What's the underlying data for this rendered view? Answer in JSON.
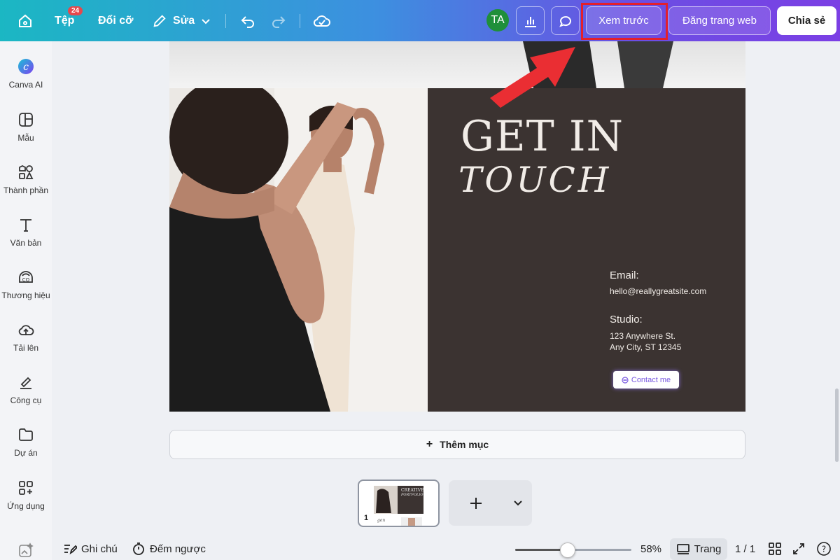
{
  "topbar": {
    "file_label": "Tệp",
    "file_badge": "24",
    "resize_label": "Đổi cỡ",
    "edit_label": "Sửa",
    "avatar_initials": "TA",
    "preview_label": "Xem trước",
    "publish_label": "Đăng trang web",
    "share_label": "Chia sẻ",
    "gradient_colors": [
      "#1bb7c3",
      "#3d8fe0",
      "#6b4fe3",
      "#7b3fe4"
    ]
  },
  "sidebar": {
    "items": [
      {
        "label": "Canva AI",
        "icon": "canva-ai-icon"
      },
      {
        "label": "Mẫu",
        "icon": "templates-icon"
      },
      {
        "label": "Thành phần",
        "icon": "elements-icon"
      },
      {
        "label": "Văn bản",
        "icon": "text-icon"
      },
      {
        "label": "Thương hiệu",
        "icon": "brand-icon"
      },
      {
        "label": "Tải lên",
        "icon": "upload-icon"
      },
      {
        "label": "Công cụ",
        "icon": "tools-icon"
      },
      {
        "label": "Dự án",
        "icon": "projects-icon"
      },
      {
        "label": "Ứng dụng",
        "icon": "apps-icon"
      }
    ]
  },
  "design": {
    "heading1": "GET IN",
    "heading2": "TOUCH",
    "email_heading": "Email:",
    "email_value": "hello@reallygreatsite.com",
    "studio_heading": "Studio:",
    "studio_line1": "123 Anywhere St.",
    "studio_line2": "Any City, ST 12345",
    "contact_button": "Contact me",
    "panel_color": "#3b3331"
  },
  "add_section_label": "Thêm mục",
  "thumbnail": {
    "page_number": "1",
    "mini_title": "CREATIVE",
    "mini_subtitle": "PORTFOLIO"
  },
  "bottombar": {
    "notes_label": "Ghi chú",
    "timer_label": "Đếm ngược",
    "zoom_level": "58%",
    "zoom_fraction": 0.45,
    "pages_label": "Trang",
    "page_count": "1 / 1"
  }
}
